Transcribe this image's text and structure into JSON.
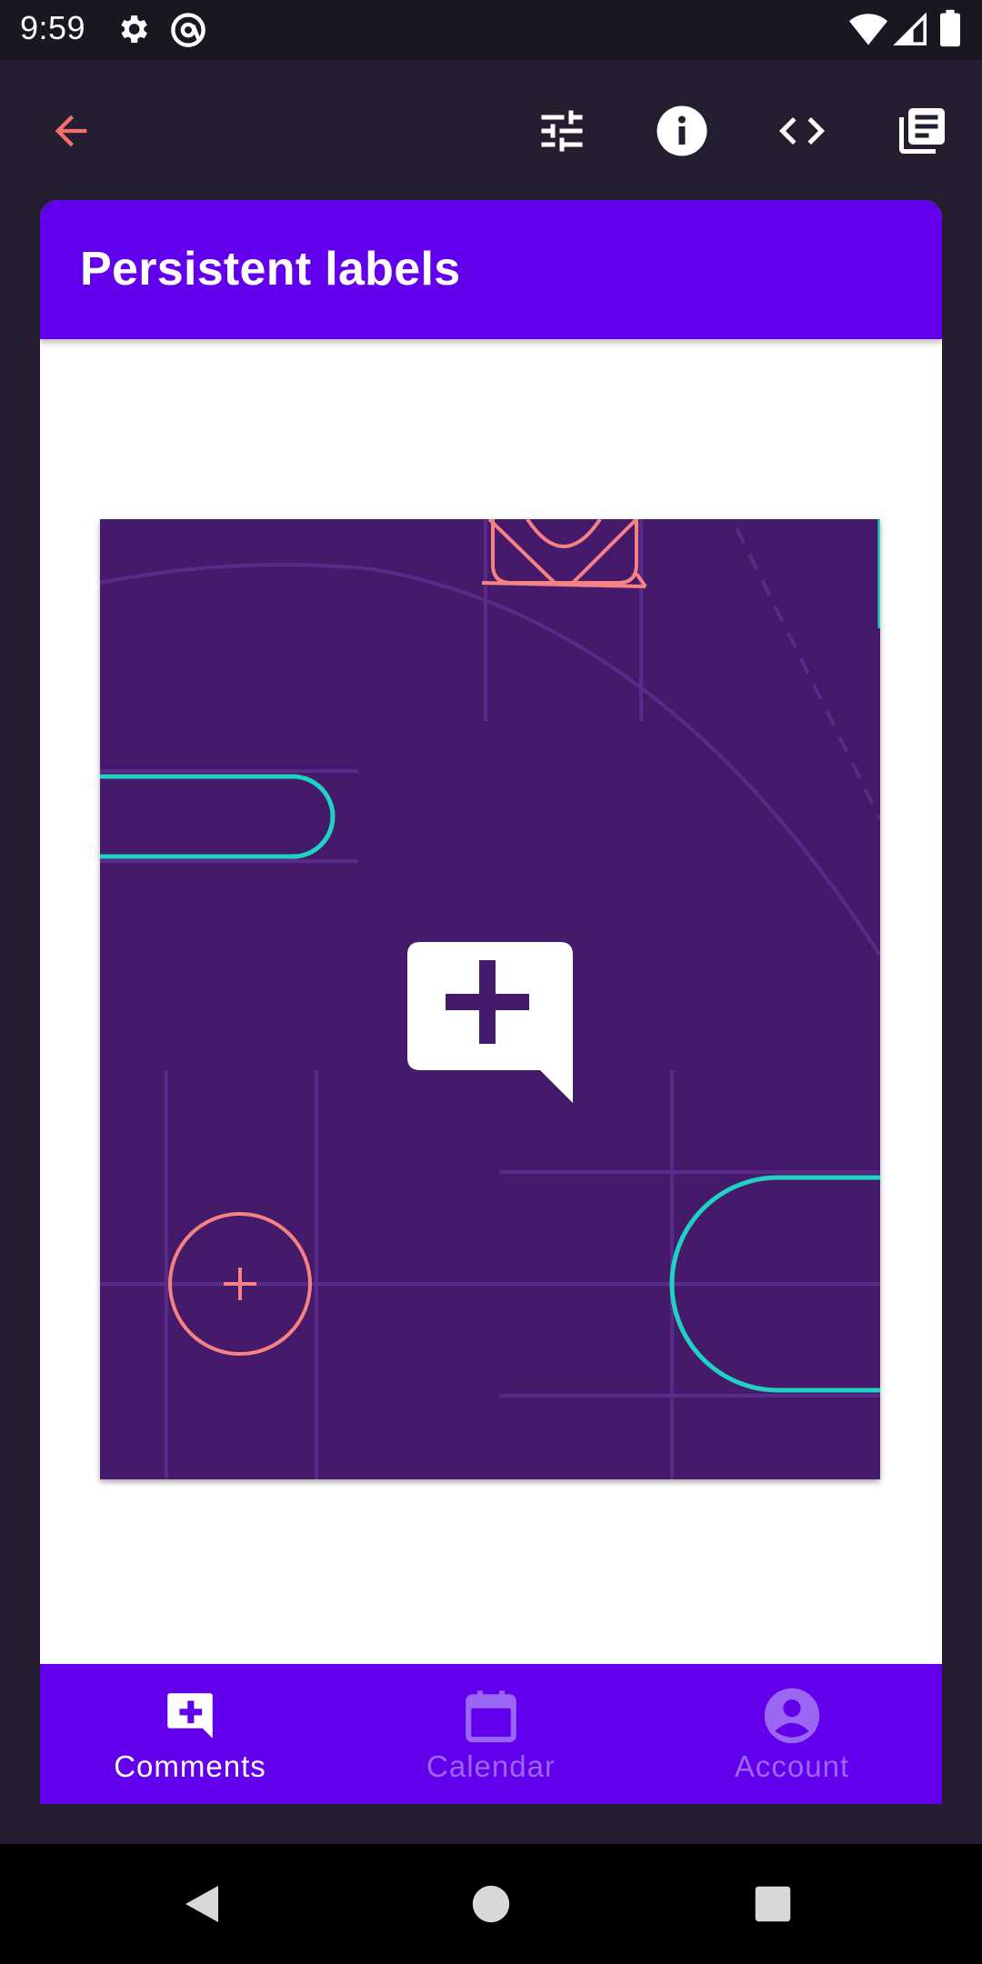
{
  "status_bar": {
    "time": "9:59",
    "icons": [
      "settings-icon",
      "at-sign-icon",
      "wifi-icon",
      "signal-icon",
      "battery-icon"
    ]
  },
  "toolbar": {
    "icons": [
      "back-arrow-icon",
      "tune-icon",
      "info-icon",
      "code-icon",
      "library-books-icon"
    ],
    "accent_color": "#f07070"
  },
  "card": {
    "title": "Persistent labels",
    "header_color": "#6200ee"
  },
  "illustration": {
    "background": "#461a6a",
    "icon": "add-comment-icon",
    "teal": "#1ed2c4",
    "coral": "#f68282"
  },
  "bottom_nav": {
    "items": [
      {
        "label": "Comments",
        "icon": "add-comment-icon",
        "selected": true
      },
      {
        "label": "Calendar",
        "icon": "calendar-icon",
        "selected": false
      },
      {
        "label": "Account",
        "icon": "account-circle-icon",
        "selected": false
      }
    ],
    "selected_color": "#ffffff",
    "unselected_color": "#9b66f2"
  },
  "system_nav": {
    "icons": [
      "back-triangle-icon",
      "home-circle-icon",
      "recents-square-icon"
    ]
  }
}
